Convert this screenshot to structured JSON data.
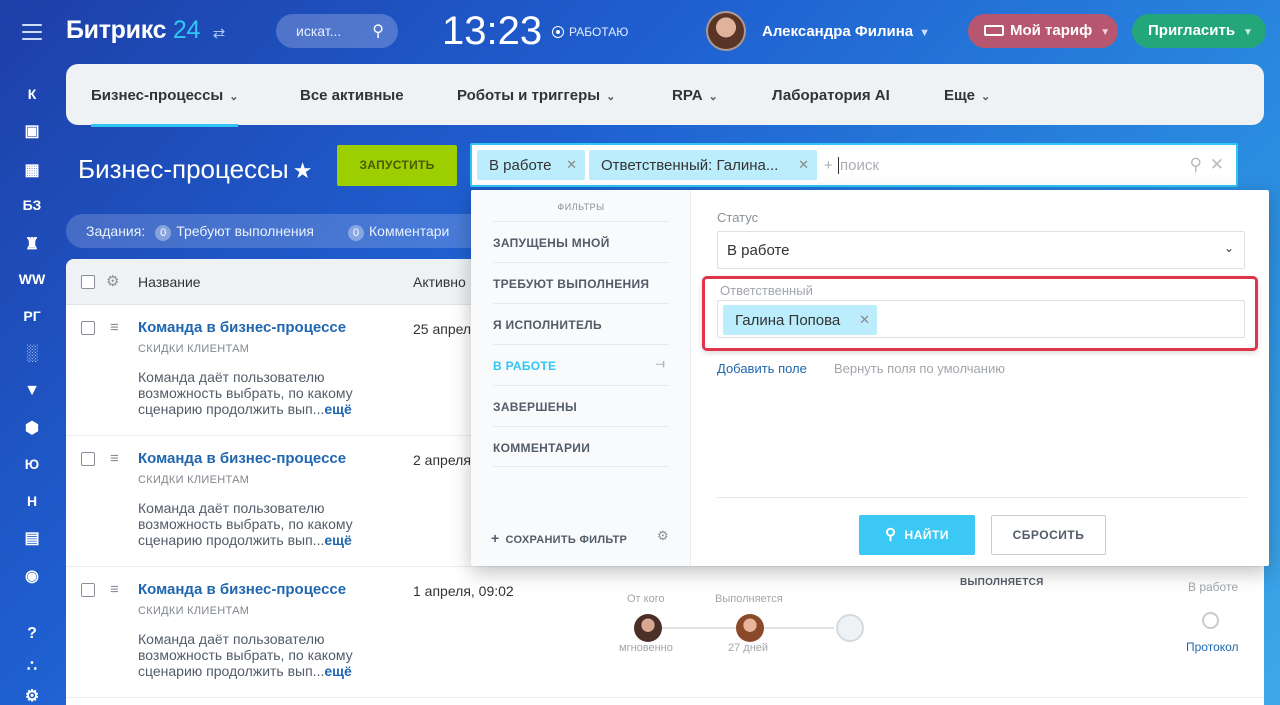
{
  "rail": {
    "items": [
      "К",
      "БЗ",
      "WW",
      "РГ",
      "Ю",
      "Н"
    ]
  },
  "header": {
    "brand_name": "Битрикс",
    "brand_num": "24",
    "search_placeholder": "искат...",
    "time": "13:23",
    "work_status": "РАБОТАЮ",
    "user_name": "Александра Филина",
    "tariff_label": "Мой тариф",
    "invite_label": "Пригласить"
  },
  "nav": {
    "items": [
      "Бизнес-процессы",
      "Все активные",
      "Роботы и триггеры",
      "RPA",
      "Лаборатория AI",
      "Еще"
    ]
  },
  "page": {
    "title": "Бизнес-процессы",
    "run_label": "ЗАПУСТИТЬ"
  },
  "filter_bar": {
    "chip1": "В работе",
    "chip2": "Ответственный: Галина...",
    "plus": "+",
    "placeholder": "поиск"
  },
  "tasks": {
    "label": "Задания:",
    "c1": "0",
    "l1": "Требуют выполнения",
    "c2": "0",
    "l2": "Комментари"
  },
  "table": {
    "col_name": "Название",
    "col_active": "Активно",
    "rows": [
      {
        "title": "Команда в бизнес-процессе",
        "sub": "СКИДКИ КЛИЕНТАМ",
        "desc": "Команда даёт пользователю возможность выбрать, по какому сценарию продолжить вып...",
        "more": "ещё",
        "date": "25 апрел"
      },
      {
        "title": "Команда в бизнес-процессе",
        "sub": "СКИДКИ КЛИЕНТАМ",
        "desc": "Команда даёт пользователю возможность выбрать, по какому сценарию продолжить вып...",
        "more": "ещё",
        "date": "2 апреля"
      },
      {
        "title": "Команда в бизнес-процессе",
        "sub": "СКИДКИ КЛИЕНТАМ",
        "desc": "Команда даёт пользователю возможность выбрать, по какому сценарию продолжить вып...",
        "more": "ещё",
        "date": "1 апреля, 09:02"
      }
    ],
    "proc": {
      "from": "От кого",
      "executing": "Выполняется",
      "status_col": "ВЫПОЛНЯЕТСЯ",
      "instant": "мгновенно",
      "days": "27 дней",
      "in_work": "В работе",
      "protocol": "Протокол"
    }
  },
  "popup": {
    "filters_header": "ФИЛЬТРЫ",
    "presets": [
      "ЗАПУЩЕНЫ МНОЙ",
      "ТРЕБУЮТ ВЫПОЛНЕНИЯ",
      "Я ИСПОЛНИТЕЛЬ",
      "В РАБОТЕ",
      "ЗАВЕРШЕНЫ",
      "КОММЕНТАРИИ"
    ],
    "active_preset": "В РАБОТЕ",
    "save_filter": "СОХРАНИТЬ ФИЛЬТР",
    "status_label": "Статус",
    "status_value": "В работе",
    "responsible_label": "Ответственный",
    "responsible_value": "Галина Попова",
    "add_field": "Добавить поле",
    "restore_fields": "Вернуть поля по умолчанию",
    "find_label": "НАЙТИ",
    "reset_label": "СБРОСИТЬ"
  },
  "colors": {
    "accent": "#2fc6f6",
    "run_button": "#9dcf00",
    "highlight": "#e0344a",
    "tariff": "#b7566f",
    "invite": "#23a67a"
  }
}
